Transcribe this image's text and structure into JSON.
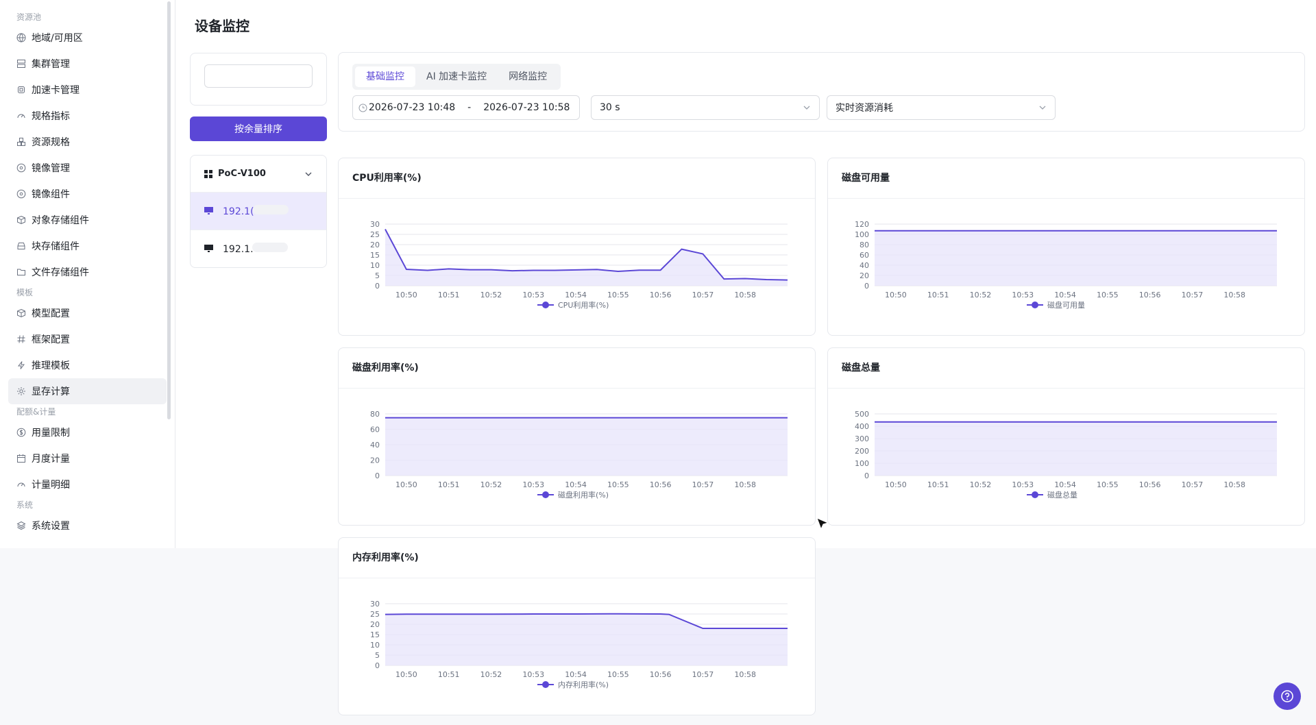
{
  "sidebar": {
    "sections": [
      {
        "label": "资源池",
        "items": [
          {
            "label": "地域/可用区",
            "icon": "globe-icon"
          },
          {
            "label": "集群管理",
            "icon": "server-icon"
          },
          {
            "label": "加速卡管理",
            "icon": "chip-icon"
          },
          {
            "label": "规格指标",
            "icon": "gauge-icon"
          },
          {
            "label": "资源规格",
            "icon": "cubes-icon"
          },
          {
            "label": "镜像管理",
            "icon": "disc-icon"
          },
          {
            "label": "镜像组件",
            "icon": "disc-icon"
          },
          {
            "label": "对象存储组件",
            "icon": "box-icon"
          },
          {
            "label": "块存储组件",
            "icon": "hdd-icon"
          },
          {
            "label": "文件存储组件",
            "icon": "folder-icon"
          }
        ]
      },
      {
        "label": "模板",
        "items": [
          {
            "label": "模型配置",
            "icon": "box-icon"
          },
          {
            "label": "框架配置",
            "icon": "hash-icon"
          },
          {
            "label": "推理模板",
            "icon": "bolt-icon"
          },
          {
            "label": "显存计算",
            "icon": "gear-icon"
          }
        ]
      },
      {
        "label": "配额&计量",
        "items": [
          {
            "label": "用量限制",
            "icon": "coin-icon"
          },
          {
            "label": "月度计量",
            "icon": "calendar-icon"
          },
          {
            "label": "计量明细",
            "icon": "gauge-icon"
          }
        ]
      },
      {
        "label": "系统",
        "items": [
          {
            "label": "系统设置",
            "icon": "layers-icon"
          }
        ]
      }
    ],
    "active_item": "显存计算"
  },
  "page": {
    "title": "设备监控"
  },
  "search": {
    "value": "",
    "placeholder": ""
  },
  "sort_button": {
    "label": "按余量排序"
  },
  "device_list": {
    "group": "PoC-V100",
    "items": [
      "192.1(",
      "192.1."
    ],
    "active_index": 0
  },
  "tabs": {
    "items": [
      "基础监控",
      "AI 加速卡监控",
      "网络监控"
    ],
    "active_index": 0
  },
  "time_range": {
    "start": "2026-07-23 10:48",
    "separator": "-",
    "end": "2026-07-23 10:58"
  },
  "interval_select": {
    "value": "30 s"
  },
  "metric_select": {
    "value": "实时资源消耗"
  },
  "colors": {
    "accent": "#5b47d6",
    "area": "#e9e6fb",
    "grid": "#e5e6eb"
  },
  "chart_data": [
    {
      "type": "area",
      "title": "CPU利用率(%)",
      "legend": "CPU利用率(%)",
      "x": [
        "10:50",
        "10:51",
        "10:52",
        "10:53",
        "10:54",
        "10:55",
        "10:56",
        "10:57",
        "10:58"
      ],
      "yticks": [
        0,
        5,
        10,
        15,
        20,
        25,
        30
      ],
      "ylim": [
        0,
        30
      ],
      "xlim": [
        0,
        9.5
      ],
      "points": [
        [
          -0.5,
          27.5
        ],
        [
          0,
          8
        ],
        [
          0.5,
          7.5
        ],
        [
          1,
          8.2
        ],
        [
          1.5,
          7.8
        ],
        [
          2,
          7.8
        ],
        [
          2.5,
          7.3
        ],
        [
          3,
          7.5
        ],
        [
          3.5,
          7.5
        ],
        [
          4,
          7.7
        ],
        [
          4.5,
          7.9
        ],
        [
          5,
          7
        ],
        [
          5.5,
          7.6
        ],
        [
          6,
          7.6
        ],
        [
          6.5,
          17.8
        ],
        [
          7,
          15.5
        ],
        [
          7.5,
          3.3
        ],
        [
          8,
          3.5
        ],
        [
          8.5,
          3
        ],
        [
          9,
          2.8
        ]
      ]
    },
    {
      "type": "area",
      "title": "磁盘可用量",
      "legend": "磁盘可用量",
      "x": [
        "10:50",
        "10:51",
        "10:52",
        "10:53",
        "10:54",
        "10:55",
        "10:56",
        "10:57",
        "10:58"
      ],
      "yticks": [
        0,
        20,
        40,
        60,
        80,
        100,
        120
      ],
      "ylim": [
        0,
        120
      ],
      "xlim": [
        0,
        9.5
      ],
      "points": [
        [
          -0.5,
          107
        ],
        [
          9,
          107
        ]
      ]
    },
    {
      "type": "area",
      "title": "磁盘利用率(%)",
      "legend": "磁盘利用率(%)",
      "x": [
        "10:50",
        "10:51",
        "10:52",
        "10:53",
        "10:54",
        "10:55",
        "10:56",
        "10:57",
        "10:58"
      ],
      "yticks": [
        0,
        20,
        40,
        60,
        80
      ],
      "ylim": [
        0,
        80
      ],
      "xlim": [
        0,
        9.5
      ],
      "points": [
        [
          -0.5,
          75
        ],
        [
          9,
          75
        ]
      ]
    },
    {
      "type": "area",
      "title": "磁盘总量",
      "legend": "磁盘总量",
      "x": [
        "10:50",
        "10:51",
        "10:52",
        "10:53",
        "10:54",
        "10:55",
        "10:56",
        "10:57",
        "10:58"
      ],
      "yticks": [
        0,
        100,
        200,
        300,
        400,
        500
      ],
      "ylim": [
        0,
        500
      ],
      "xlim": [
        0,
        9.5
      ],
      "points": [
        [
          -0.5,
          435
        ],
        [
          9,
          435
        ]
      ]
    },
    {
      "type": "area",
      "title": "内存利用率(%)",
      "legend": "内存利用率(%)",
      "x": [
        "10:50",
        "10:51",
        "10:52",
        "10:53",
        "10:54",
        "10:55",
        "10:56",
        "10:57",
        "10:58"
      ],
      "yticks": [
        0,
        5,
        10,
        15,
        20,
        25,
        30
      ],
      "ylim": [
        0,
        30
      ],
      "xlim": [
        0,
        9.5
      ],
      "points": [
        [
          -0.5,
          24.8
        ],
        [
          0,
          24.9
        ],
        [
          1,
          24.9
        ],
        [
          2,
          24.9
        ],
        [
          3,
          25
        ],
        [
          4,
          25
        ],
        [
          5,
          25.1
        ],
        [
          6,
          25
        ],
        [
          6.2,
          24.8
        ],
        [
          7,
          18
        ],
        [
          8,
          18
        ],
        [
          9,
          18
        ]
      ]
    }
  ]
}
